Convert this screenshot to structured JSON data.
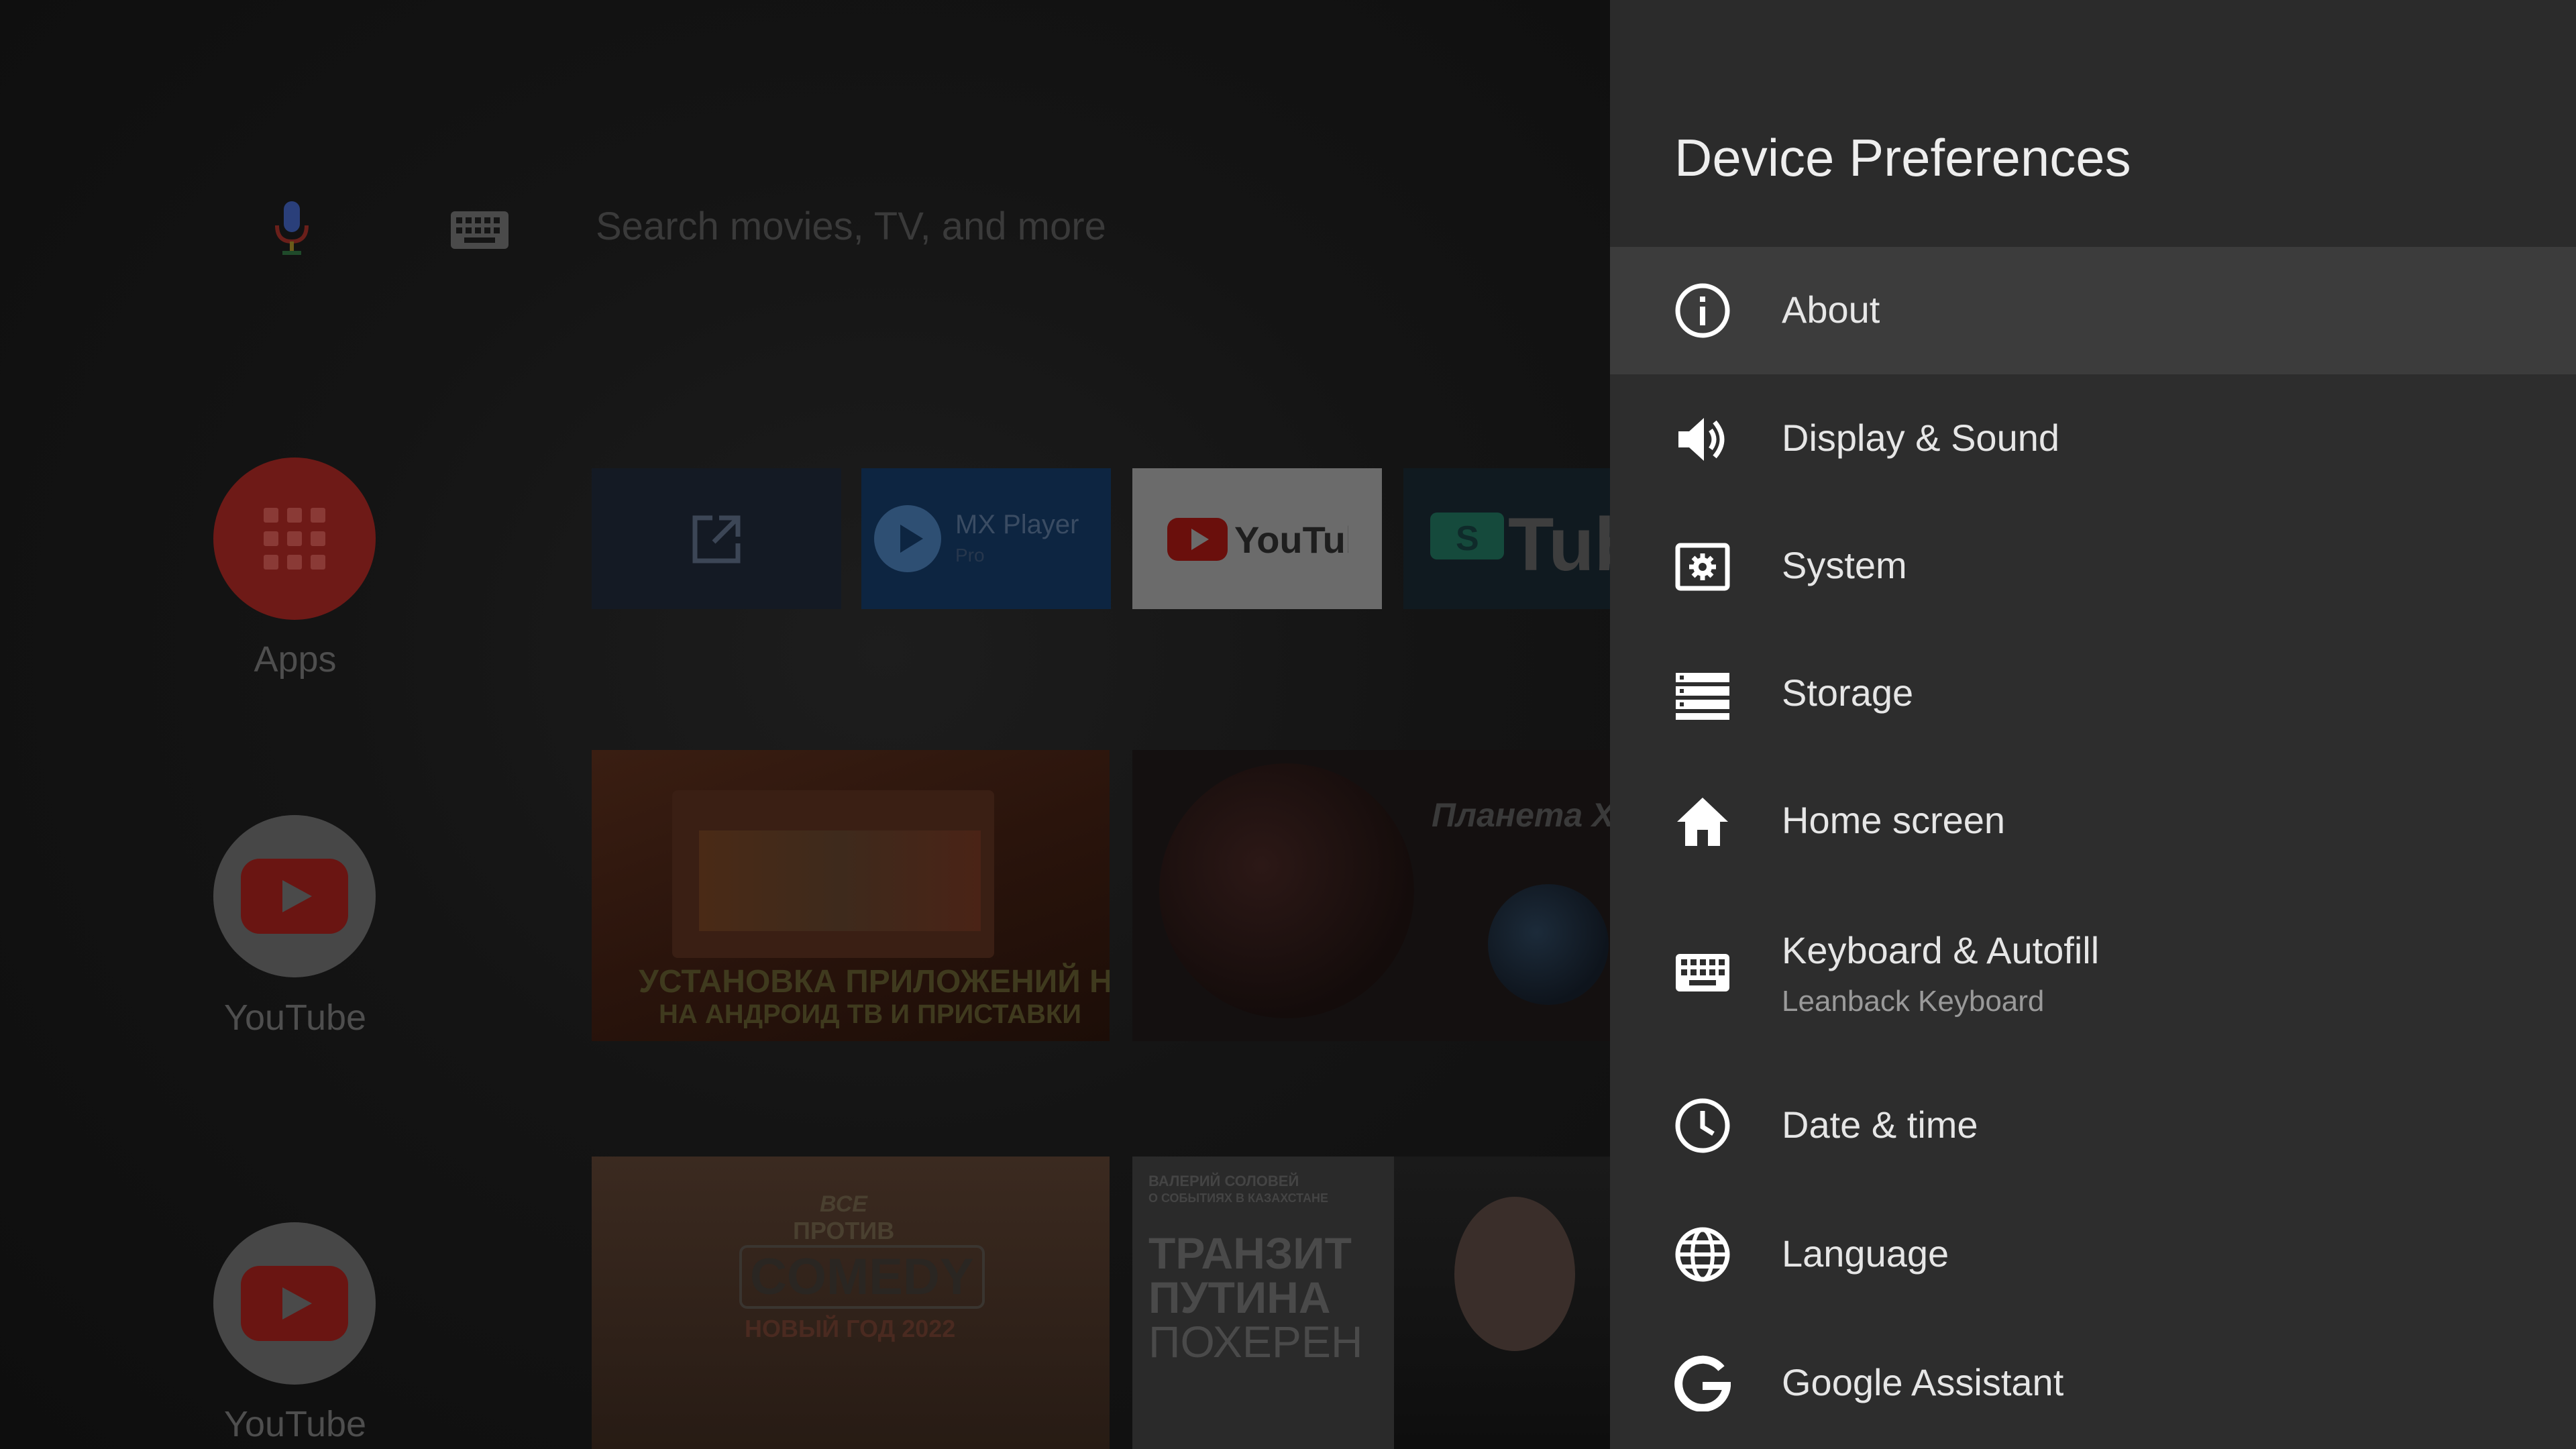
{
  "launcher": {
    "search_placeholder": "Search movies, TV, and more",
    "side_items": [
      {
        "label": "Apps"
      },
      {
        "label": "YouTube"
      },
      {
        "label": "YouTube"
      }
    ],
    "app_chips": {
      "mx_player": "MX Player",
      "mx_player_sub": "Pro"
    },
    "thumbnails": {
      "t1_line1": "УСТАНОВКА ПРИЛОЖЕНИЙ НА",
      "t1_line2": "НА АНДРОИД ТВ И ПРИСТАВКИ",
      "t2_title": "Планета Х",
      "t3_line1": "ВСЕ",
      "t3_line2": "ПРОТИВ",
      "t3_line3": "COMEDY",
      "t3_line4": "НОВЫЙ ГОД 2022",
      "t4_top1": "ВАЛЕРИЙ СОЛОВЕЙ",
      "t4_top2": "О СОБЫТИЯХ В КАЗАХСТАНЕ",
      "t4_line1": "ТРАНЗИТ",
      "t4_line2": "ПУТИНА",
      "t4_line3": "ПОХЕРЕН"
    }
  },
  "panel": {
    "title": "Device Preferences",
    "items": [
      {
        "label": "About",
        "icon": "info-icon",
        "focused": true
      },
      {
        "label": "Display & Sound",
        "icon": "speaker-icon"
      },
      {
        "label": "System",
        "icon": "system-settings-icon"
      },
      {
        "label": "Storage",
        "icon": "storage-icon"
      },
      {
        "label": "Home screen",
        "icon": "home-icon"
      },
      {
        "label": "Keyboard & Autofill",
        "sublabel": "Leanback Keyboard",
        "icon": "keyboard-icon"
      },
      {
        "label": "Date & time",
        "icon": "clock-icon"
      },
      {
        "label": "Language",
        "icon": "globe-icon"
      },
      {
        "label": "Google Assistant",
        "icon": "google-g-icon"
      }
    ]
  },
  "colors": {
    "panel_bg": "#2d2d2d",
    "focus_bg": "#3c3c3c",
    "text_primary": "#e6e6e6",
    "text_secondary": "#9a9a9a",
    "accent_red": "#ff0000"
  }
}
